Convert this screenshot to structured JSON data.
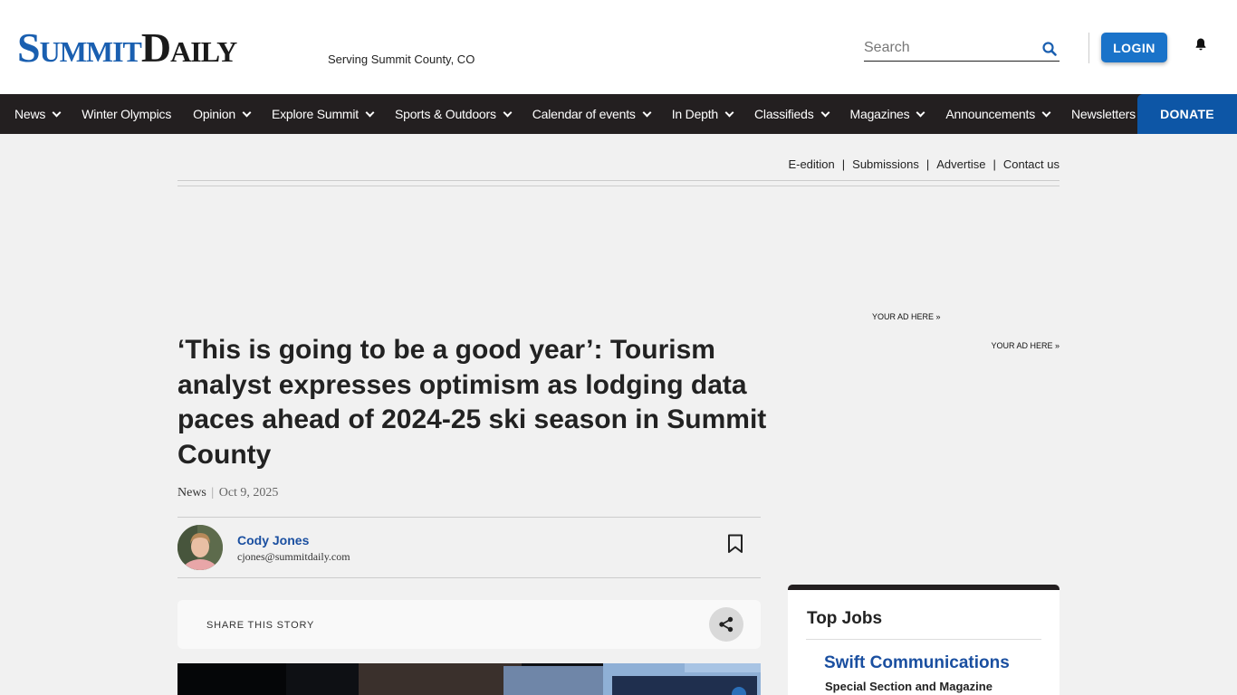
{
  "header": {
    "logo_part1": "Summit",
    "logo_part2": "Daily",
    "tagline": "Serving Summit County, CO",
    "search_placeholder": "Search",
    "login_label": "LOGIN"
  },
  "nav": {
    "items": [
      {
        "label": "News",
        "dropdown": true
      },
      {
        "label": "Winter Olympics",
        "dropdown": false
      },
      {
        "label": "Opinion",
        "dropdown": true
      },
      {
        "label": "Explore Summit",
        "dropdown": true
      },
      {
        "label": "Sports & Outdoors",
        "dropdown": true
      },
      {
        "label": "Calendar of events",
        "dropdown": true
      },
      {
        "label": "In Depth",
        "dropdown": true
      },
      {
        "label": "Classifieds",
        "dropdown": true
      },
      {
        "label": "Magazines",
        "dropdown": true
      },
      {
        "label": "Announcements",
        "dropdown": true
      },
      {
        "label": "Newsletters",
        "dropdown": false
      }
    ],
    "donate_label": "DONATE"
  },
  "utility_links": [
    "E-edition",
    "Submissions",
    "Advertise",
    "Contact us"
  ],
  "ads": {
    "ad1": "YOUR AD HERE »",
    "ad2": "YOUR AD HERE »"
  },
  "article": {
    "headline": "‘This is going to be a good year’: Tourism analyst expresses optimism as lodging data paces ahead of 2024-25 ski season in Summit County",
    "section": "News",
    "date": "Oct 9, 2025",
    "author_name": "Cody Jones",
    "author_email": "cjones@summitdaily.com",
    "share_label": "SHARE THIS STORY"
  },
  "top_jobs": {
    "title": "Top Jobs",
    "company": "Swift Communications",
    "role": "Special Section and Magazine"
  },
  "colors": {
    "brand_blue": "#1a5fb0",
    "nav_bg": "#231f20",
    "donate_bg": "#0d56a6",
    "login_bg": "#1a73c9",
    "link_blue": "#1a4fa0"
  }
}
